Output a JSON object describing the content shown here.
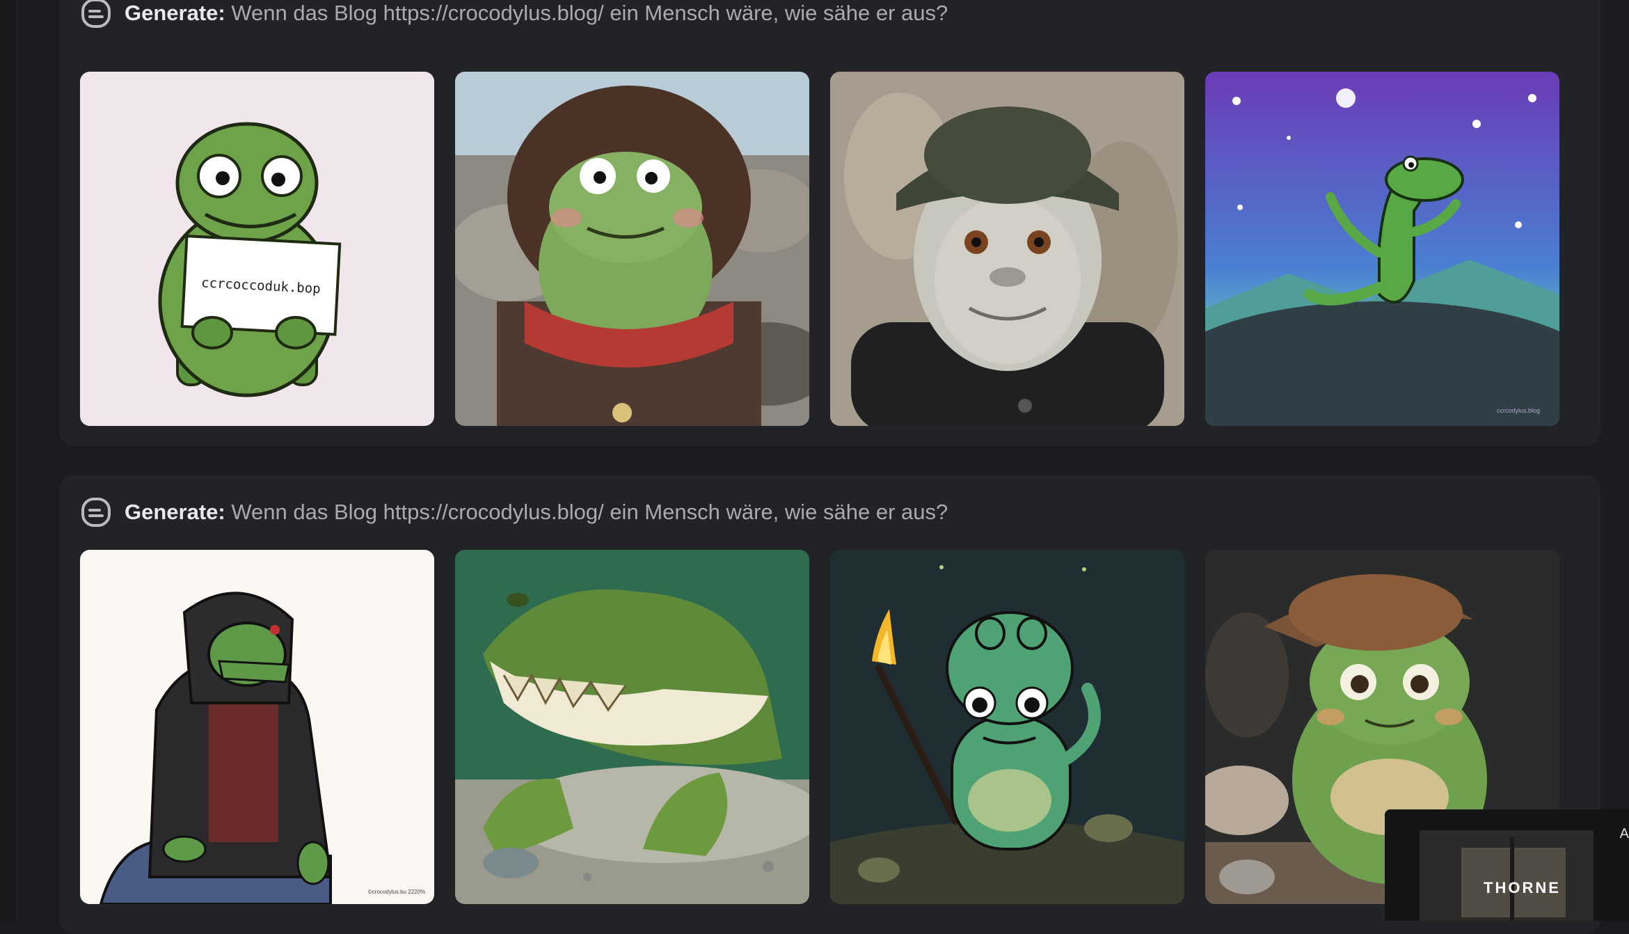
{
  "cards": [
    {
      "lead": "Generate:",
      "prompt": "Wenn das Blog https://crocodylus.blog/ ein Mensch wäre, wie sähe er aus?",
      "images": [
        {
          "sign_text": "ccrcoccoduk.bop"
        },
        {},
        {},
        {
          "watermark": "ccrcodylus.blog"
        }
      ]
    },
    {
      "lead": "Generate:",
      "prompt": "Wenn das Blog https://crocodylus.blog/ ein Mensch wäre, wie sähe er aus?",
      "images": [
        {
          "watermark": "©crocodylus.bu 2220%"
        },
        {},
        {},
        {}
      ]
    }
  ],
  "overlay": {
    "title": "THORNE",
    "corner_letter": "A"
  },
  "colors": {
    "background": "#1b1c1f",
    "card": "#222327",
    "lead_text": "#eaeaec",
    "prompt_text": "#a9abb0",
    "croc_green": "#6fa34a"
  }
}
